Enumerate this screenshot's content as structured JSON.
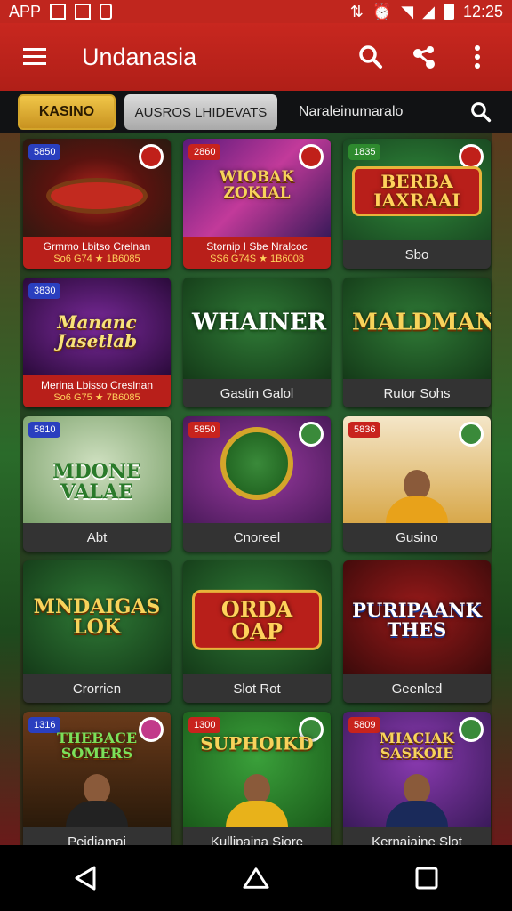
{
  "status_bar": {
    "app_label": "APP",
    "time": "12:25"
  },
  "app_bar": {
    "title": "Undanasia"
  },
  "tabs": {
    "kasino": "KASINO",
    "second": "AUSROS LHIDEVATS",
    "third": "Naraleinumaralo"
  },
  "tiles": [
    {
      "badge": "5850",
      "art": "",
      "name": "Grmmo Lbitso Crelnan",
      "sub": "So6 G74 ★ 1B6085"
    },
    {
      "badge": "2860",
      "art": "WIOBAK ZOKIAL",
      "name": "Stornip I Sbe Nralcoc",
      "sub": "SS6 G74S ★ 1B6008"
    },
    {
      "badge": "1835",
      "art": "BERBA IAXRAAI",
      "name": "Sbo"
    },
    {
      "badge": "3830",
      "art": "Mananc Jasetlab",
      "name": "Merina Lbisso Creslnan",
      "sub": "So6 G75 ★ 7B6085"
    },
    {
      "badge": "",
      "art": "WHAINER",
      "name": "Gastin Galol"
    },
    {
      "badge": "",
      "art": "MALDMAND",
      "name": "Rutor Sohs"
    },
    {
      "badge": "5810",
      "art": "MDONE VALAE",
      "name": "Abt"
    },
    {
      "badge": "5850",
      "art": "",
      "name": "Cnoreel"
    },
    {
      "badge": "5836",
      "art": "",
      "name": "Gusino"
    },
    {
      "badge": "",
      "art": "MNDAIGAS LOK",
      "name": "Crorrien"
    },
    {
      "badge": "",
      "art": "ORDA OAP",
      "name": "Slot Rot"
    },
    {
      "badge": "",
      "art": "PURIPAANK THES",
      "name": "Geenled"
    },
    {
      "badge": "1316",
      "art": "THEBACE SOMERS",
      "name": "Peidiamai"
    },
    {
      "badge": "1300",
      "art": "SUPHOIKD",
      "name": "Kullipaina Siore"
    },
    {
      "badge": "5809",
      "art": "MIACIAK SASKOIE",
      "name": "Kernaiaine Slot"
    }
  ],
  "colors": {
    "accent_red": "#c0261e",
    "gold": "#d4a52a"
  }
}
